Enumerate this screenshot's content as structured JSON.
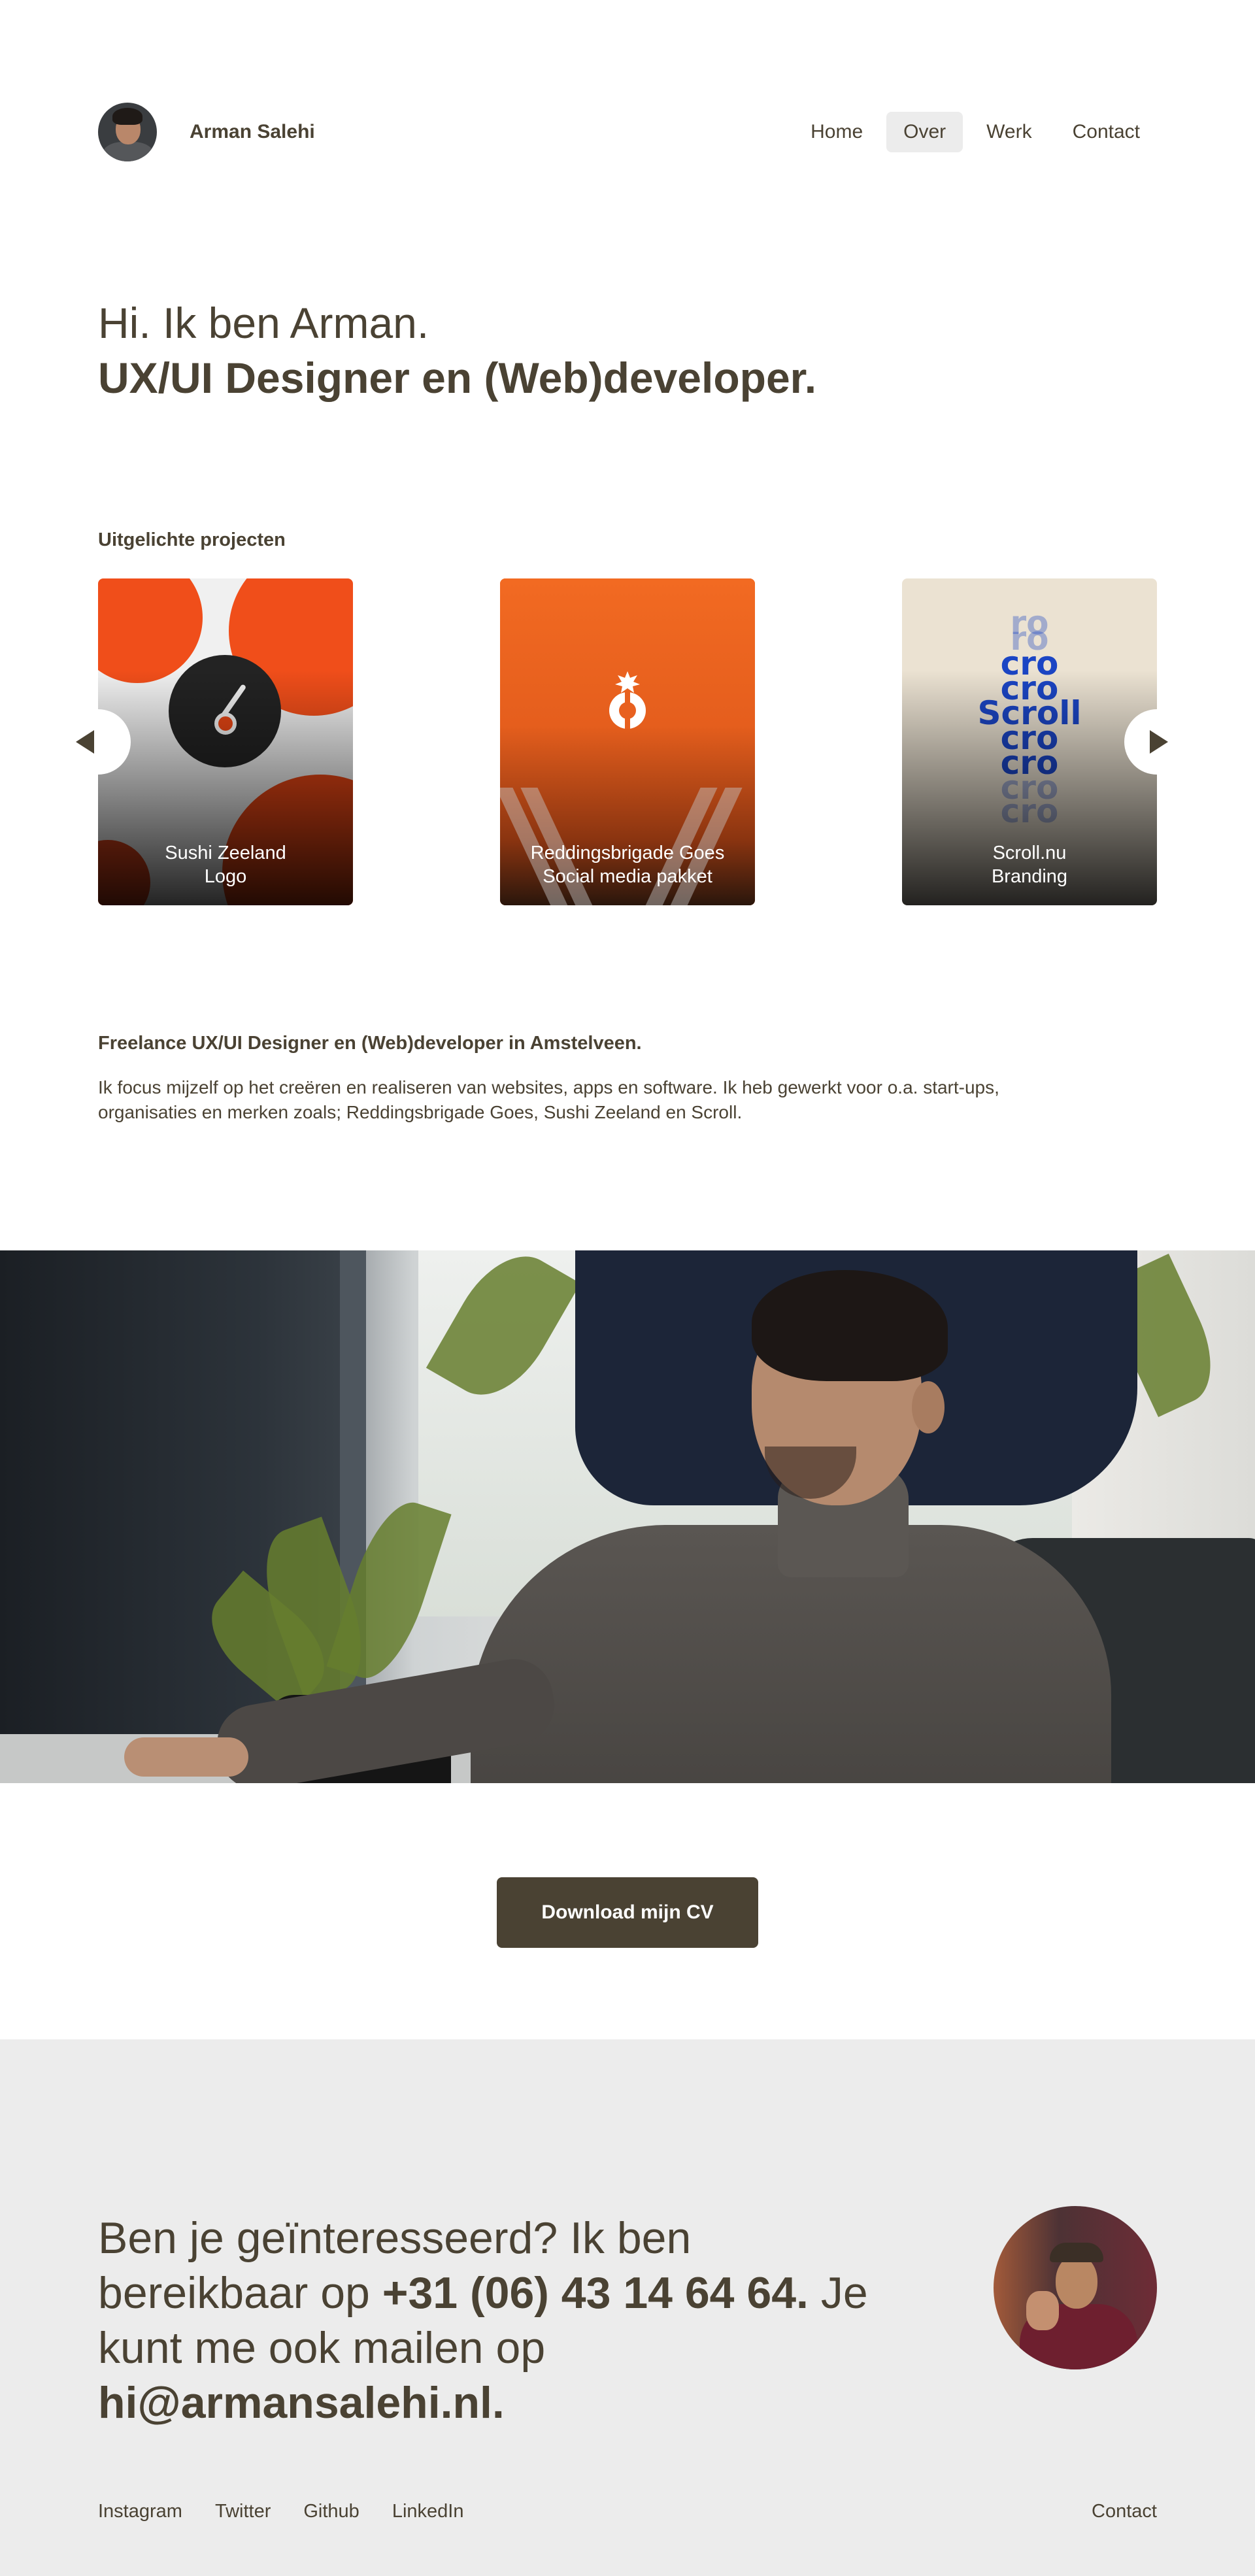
{
  "header": {
    "name": "Arman Salehi",
    "nav": [
      {
        "label": "Home"
      },
      {
        "label": "Over"
      },
      {
        "label": "Werk"
      },
      {
        "label": "Contact"
      }
    ]
  },
  "hero": {
    "line1": "Hi. Ik ben Arman.",
    "line2": "UX/UI Designer en (Web)developer."
  },
  "featured": {
    "label": "Uitgelichte projecten",
    "projects": [
      {
        "line1": "Sushi Zeeland",
        "line2": "Logo"
      },
      {
        "line1": "Reddingsbrigade Goes",
        "line2": "Social media pakket"
      },
      {
        "line1": "Scroll.nu",
        "line2": "Branding"
      }
    ],
    "scroll_word": {
      "top": "ro",
      "mid": "cro",
      "main_left": "S",
      "main_mid": "cro",
      "main_right": "ll"
    },
    "logo_letter": "R"
  },
  "intro": {
    "title": "Freelance UX/UI Designer en (Web)developer in Amstelveen.",
    "text": "Ik focus mijzelf op het creëren en realiseren van websites, apps en software. Ik heb gewerkt voor o.a. start-ups, organisaties en merken zoals; Reddingsbrigade Goes, Sushi Zeeland en Scroll."
  },
  "cv": {
    "label": "Download mijn CV"
  },
  "contact": {
    "part1": "Ben je geïnteresseerd? Ik ben bereikbaar op ",
    "phone": "+31 (06) 43 14 64 64.",
    "part2": " Je kunt me ook mailen op ",
    "email": "hi@armansalehi.nl."
  },
  "footer": {
    "links": [
      "Instagram",
      "Twitter",
      "Github",
      "LinkedIn"
    ],
    "contact": "Contact"
  },
  "colors": {
    "text": "#4a4233",
    "button": "#4a4233",
    "nav_active_bg": "#ececec",
    "footer_bg": "#ececec",
    "accent_orange": "#f26a22",
    "scroll_blue": "#1b45c4"
  },
  "icons": [
    "arrow-left-icon",
    "arrow-right-icon"
  ]
}
